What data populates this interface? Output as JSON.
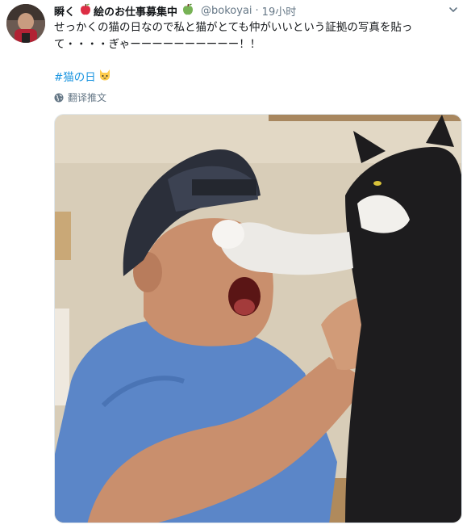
{
  "user": {
    "name": "瞬く",
    "name_suffix": "絵のお仕事募集中",
    "handle": "@bokoyai",
    "time": "19小时",
    "emoji_red_apple": "red-apple-icon",
    "emoji_green_apple": "green-apple-icon"
  },
  "tweet": {
    "text": "せっかくの猫の日なので私と猫がとても仲がいいという証拠の写真を貼って・・・・ぎゃーーーーーーーーーー！！",
    "hashtag": "#猫の日",
    "hashtag_emoji": "cat-face-icon",
    "translate_label": "翻译推文"
  },
  "colors": {
    "link": "#1b95e0",
    "secondary": "#657786",
    "text": "#14171a"
  }
}
